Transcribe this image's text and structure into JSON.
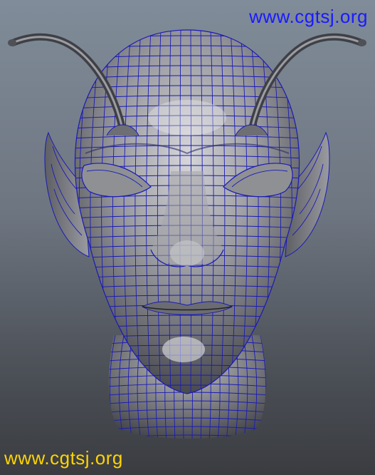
{
  "viewport": {
    "subject": "wireframe-head-model",
    "colors": {
      "wire": "#1a1ab8",
      "skin_light": "#d9d9dc",
      "skin_mid": "#8e8f94",
      "skin_dark": "#3b3c40"
    }
  },
  "watermarks": {
    "top_right": "www.cgtsj.org",
    "bottom_left": "www.cgtsj.org",
    "top_right_color": "#1a1aff",
    "bottom_left_color": "#ffd400"
  }
}
